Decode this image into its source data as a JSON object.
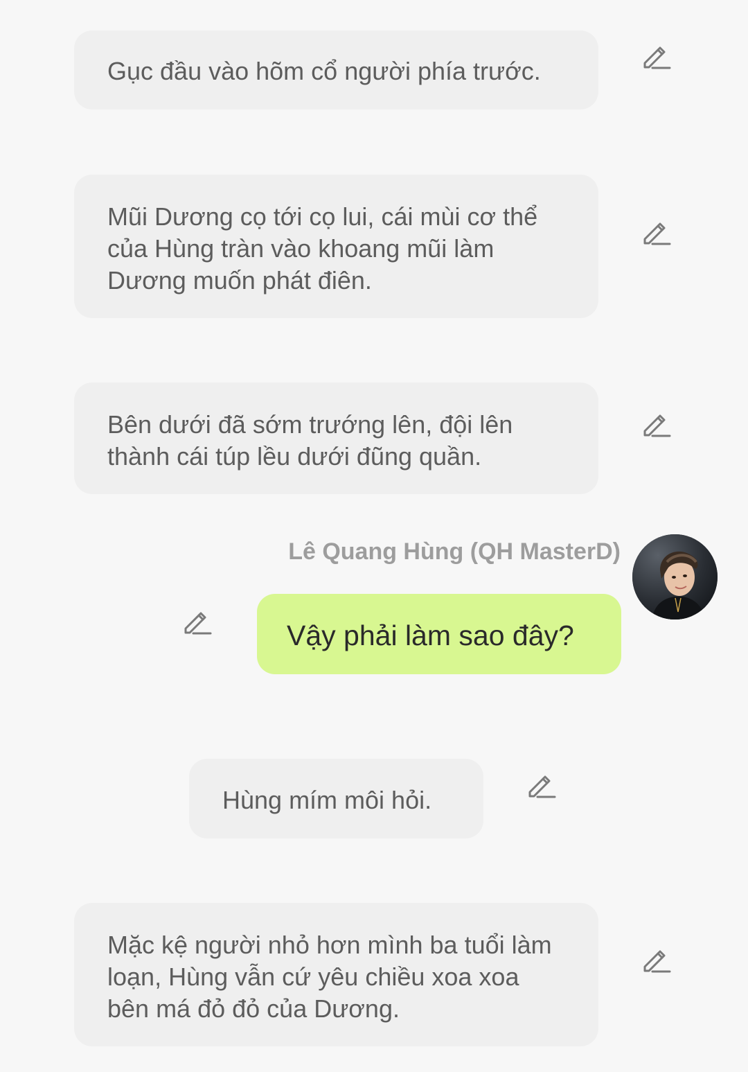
{
  "messages": [
    {
      "type": "narration",
      "text": "Gục đầu vào hõm cổ người phía trước."
    },
    {
      "type": "narration",
      "text": "Mũi Dương cọ tới cọ lui, cái mùi cơ thể của Hùng tràn vào khoang mũi làm Dương muốn phát điên."
    },
    {
      "type": "narration",
      "text": "Bên dưới đã sớm trướng lên, đội lên thành cái túp lều dưới đũng quần."
    },
    {
      "type": "character",
      "sender": "Lê Quang Hùng (QH MasterD)",
      "text": "Vậy phải làm sao đây?"
    },
    {
      "type": "narration",
      "text": "Hùng mím môi hỏi."
    },
    {
      "type": "narration",
      "text": "Mặc kệ người nhỏ hơn mình ba tuổi làm loạn, Hùng vẫn cứ yêu chiều xoa xoa bên má đỏ đỏ của Dương."
    }
  ],
  "icons": {
    "edit": "pencil-edit-icon",
    "avatar": "avatar-image"
  },
  "colors": {
    "background": "#f7f7f7",
    "narration_bubble": "#efefef",
    "character_bubble": "#d8f791",
    "narration_text": "#5c5c5c",
    "sender_name": "#9d9d9d",
    "icon": "#7a7a7a"
  }
}
